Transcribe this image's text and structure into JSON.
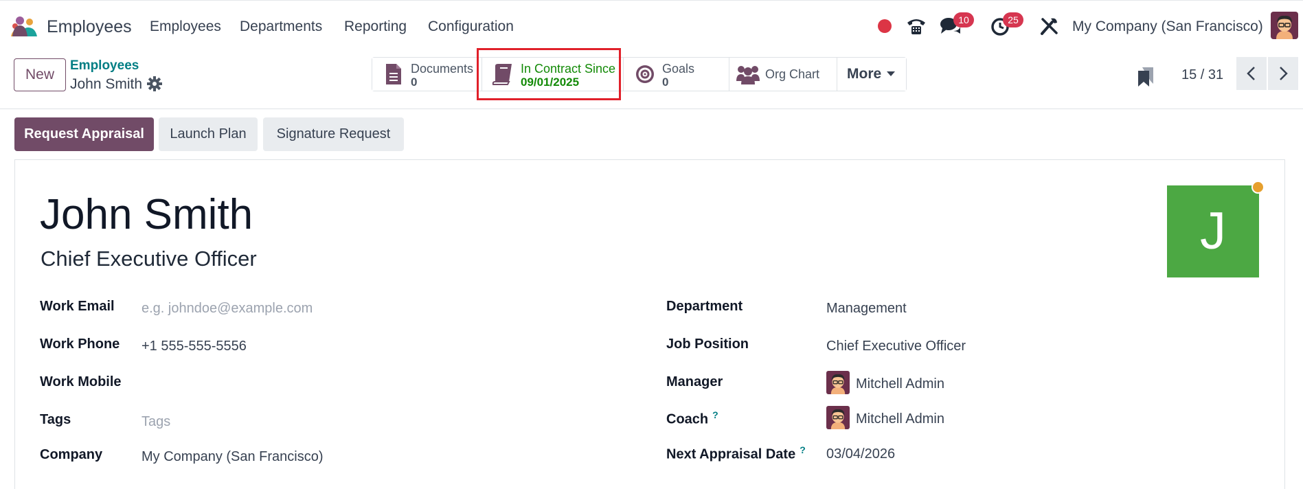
{
  "topnav": {
    "app_name": "Employees",
    "menu": [
      "Employees",
      "Departments",
      "Reporting",
      "Configuration"
    ],
    "messages_badge": "10",
    "activities_badge": "25",
    "company": "My Company (San Francisco)"
  },
  "control": {
    "new_label": "New",
    "breadcrumb_parent": "Employees",
    "breadcrumb_current": "John Smith",
    "smart_buttons": {
      "documents": {
        "label": "Documents",
        "value": "0"
      },
      "contract": {
        "label": "In Contract Since",
        "value": "09/01/2025"
      },
      "goals": {
        "label": "Goals",
        "value": "0"
      },
      "org_chart": {
        "label": "Org Chart"
      },
      "more": {
        "label": "More"
      }
    },
    "pager": "15 / 31"
  },
  "actions": {
    "request_appraisal": "Request Appraisal",
    "launch_plan": "Launch Plan",
    "signature_request": "Signature Request"
  },
  "employee": {
    "name": "John Smith",
    "job_title": "Chief Executive Officer",
    "avatar_letter": "J",
    "left_fields": {
      "work_email": {
        "label": "Work Email",
        "placeholder": "e.g. johndoe@example.com"
      },
      "work_phone": {
        "label": "Work Phone",
        "value": "+1 555-555-5556"
      },
      "work_mobile": {
        "label": "Work Mobile"
      },
      "tags": {
        "label": "Tags",
        "placeholder": "Tags"
      },
      "company": {
        "label": "Company",
        "value": "My Company (San Francisco)"
      }
    },
    "right_fields": {
      "department": {
        "label": "Department",
        "value": "Management"
      },
      "job_position": {
        "label": "Job Position",
        "value": "Chief Executive Officer"
      },
      "manager": {
        "label": "Manager",
        "value": "Mitchell Admin"
      },
      "coach": {
        "label": "Coach",
        "help": "?",
        "value": "Mitchell Admin"
      },
      "next_appraisal": {
        "label": "Next Appraisal Date",
        "help": "?",
        "value": "03/04/2026"
      }
    }
  },
  "colors": {
    "brand": "#714b67",
    "teal": "#017e84",
    "contract_green": "#138a07",
    "avatar_green": "#4ca843",
    "badge_red": "#d63650",
    "highlight_red": "#e0202a"
  }
}
